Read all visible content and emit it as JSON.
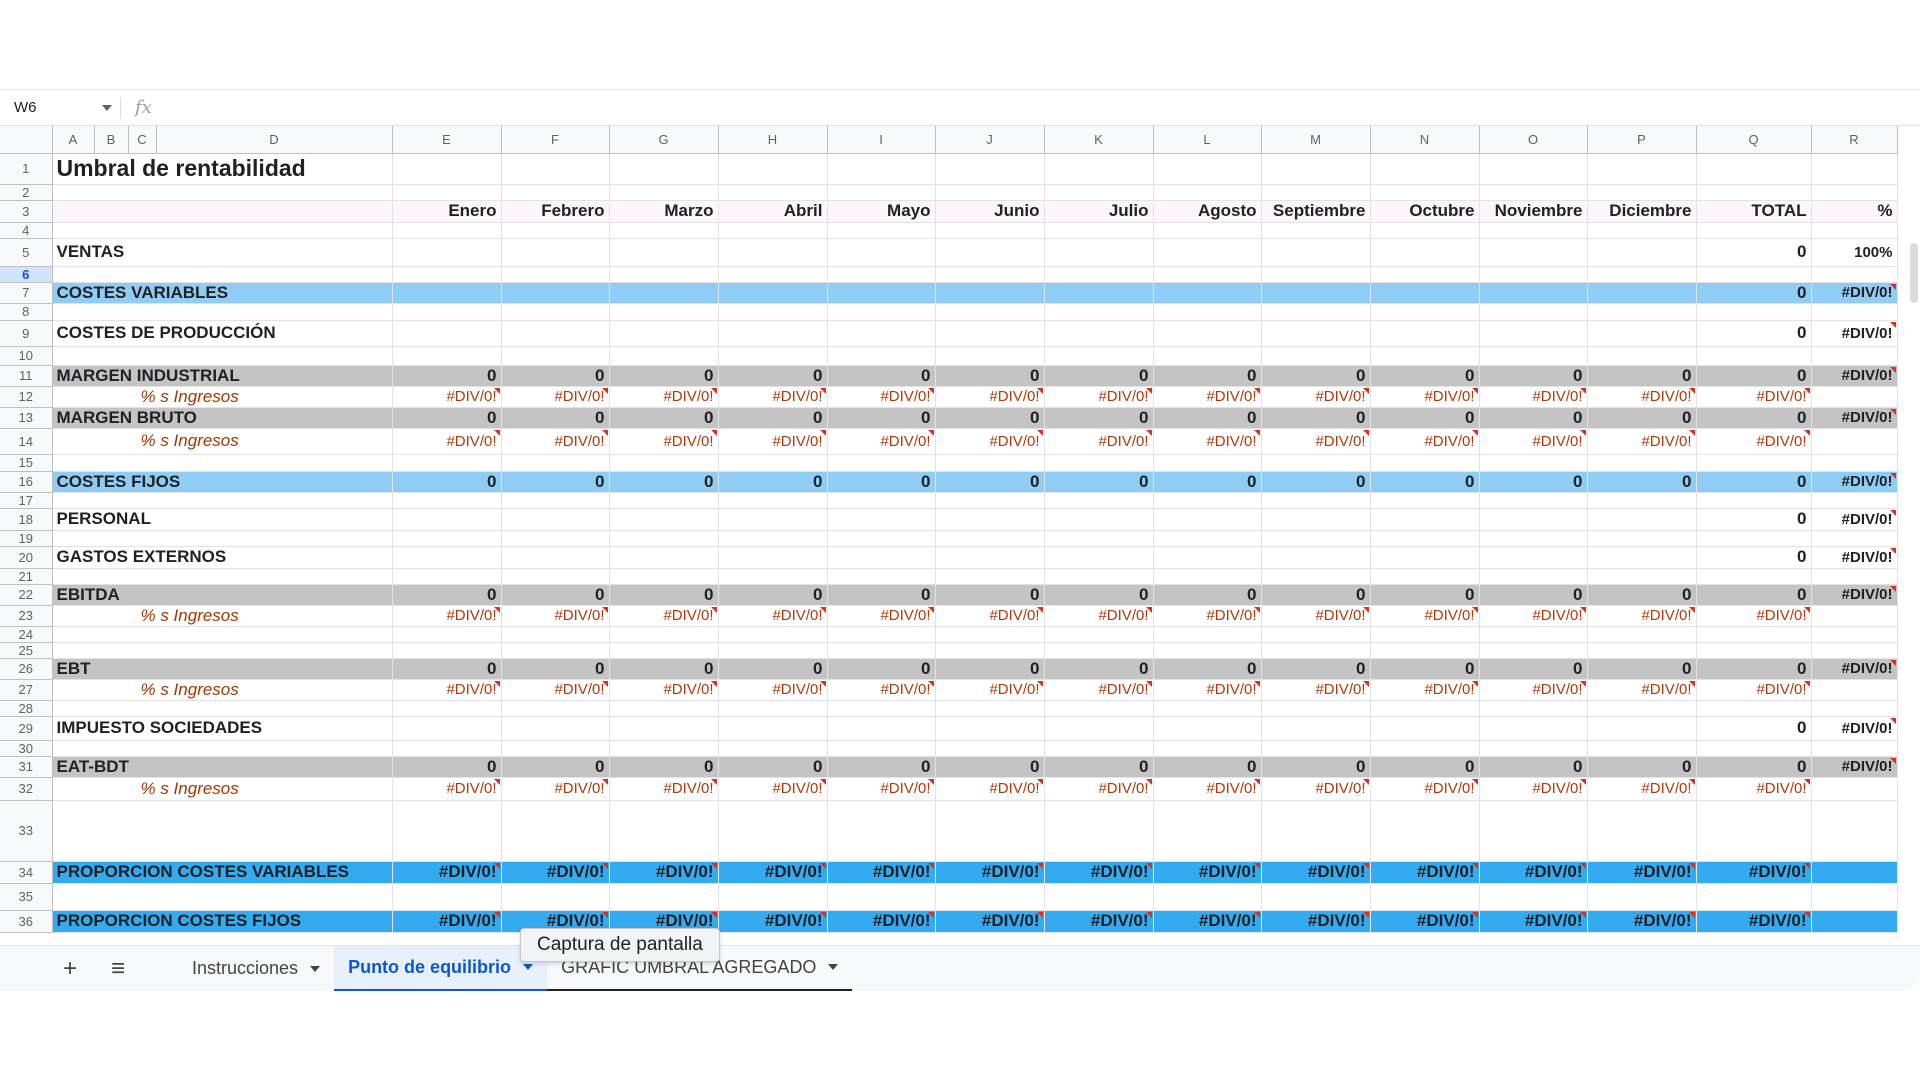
{
  "formula_bar": {
    "cell_ref": "W6",
    "fx_label": "fx",
    "formula": ""
  },
  "columns": [
    "A",
    "B",
    "C",
    "D",
    "E",
    "F",
    "G",
    "H",
    "I",
    "J",
    "K",
    "L",
    "M",
    "N",
    "O",
    "P",
    "Q",
    "R"
  ],
  "months": [
    "Enero",
    "Febrero",
    "Marzo",
    "Abril",
    "Mayo",
    "Junio",
    "Julio",
    "Agosto",
    "Septiembre",
    "Octubre",
    "Noviembre",
    "Diciembre"
  ],
  "title": "Umbral de rentabilidad",
  "header_total": "TOTAL",
  "header_pct": "%",
  "rows": [
    {
      "n": "1",
      "kind": "title"
    },
    {
      "n": "2",
      "kind": "blank"
    },
    {
      "n": "3",
      "kind": "header"
    },
    {
      "n": "4",
      "kind": "blank"
    },
    {
      "n": "5",
      "kind": "label",
      "label": "VENTAS",
      "total": "0",
      "pct": "100%",
      "pct_tri": false
    },
    {
      "n": "6",
      "kind": "blank",
      "selected": true
    },
    {
      "n": "7",
      "kind": "label",
      "style": "blue",
      "label": "COSTES VARIABLES",
      "total": "0",
      "pct": "#DIV/0!",
      "pct_tri": true
    },
    {
      "n": "8",
      "kind": "blank"
    },
    {
      "n": "9",
      "kind": "label",
      "label": "COSTES DE PRODUCCIÓN",
      "total": "0",
      "pct": "#DIV/0!",
      "pct_tri": true
    },
    {
      "n": "10",
      "kind": "blank"
    },
    {
      "n": "11",
      "kind": "months",
      "style": "grey",
      "label": "MARGEN INDUSTRIAL",
      "value": "0",
      "total": "0",
      "pct": "#DIV/0!"
    },
    {
      "n": "12",
      "kind": "pctrow",
      "label": "% s Ingresos",
      "value": "#DIV/0!"
    },
    {
      "n": "13",
      "kind": "months",
      "style": "grey",
      "label": "MARGEN BRUTO",
      "value": "0",
      "total": "0",
      "pct": "#DIV/0!"
    },
    {
      "n": "14",
      "kind": "pctrow",
      "label": "% s Ingresos",
      "value": "#DIV/0!"
    },
    {
      "n": "15",
      "kind": "blank"
    },
    {
      "n": "16",
      "kind": "months",
      "style": "blue",
      "label": "COSTES FIJOS",
      "value": "0",
      "total": "0",
      "pct": "#DIV/0!"
    },
    {
      "n": "17",
      "kind": "blank"
    },
    {
      "n": "18",
      "kind": "label",
      "label": "PERSONAL",
      "total": "0",
      "pct": "#DIV/0!",
      "pct_tri": true
    },
    {
      "n": "19",
      "kind": "blank"
    },
    {
      "n": "20",
      "kind": "label",
      "label": "GASTOS EXTERNOS",
      "total": "0",
      "pct": "#DIV/0!",
      "pct_tri": true
    },
    {
      "n": "21",
      "kind": "blank"
    },
    {
      "n": "22",
      "kind": "months",
      "style": "grey",
      "label": "EBITDA",
      "value": "0",
      "total": "0",
      "pct": "#DIV/0!"
    },
    {
      "n": "23",
      "kind": "pctrow",
      "label": "% s Ingresos",
      "value": "#DIV/0!"
    },
    {
      "n": "24",
      "kind": "blank"
    },
    {
      "n": "25",
      "kind": "blank"
    },
    {
      "n": "26",
      "kind": "months",
      "style": "grey",
      "label": "EBT",
      "value": "0",
      "total": "0",
      "pct": "#DIV/0!"
    },
    {
      "n": "27",
      "kind": "pctrow",
      "label": "% s Ingresos",
      "value": "#DIV/0!"
    },
    {
      "n": "28",
      "kind": "blank"
    },
    {
      "n": "29",
      "kind": "label",
      "label": "IMPUESTO SOCIEDADES",
      "total": "0",
      "pct": "#DIV/0!",
      "pct_tri": true
    },
    {
      "n": "30",
      "kind": "blank"
    },
    {
      "n": "31",
      "kind": "months",
      "style": "grey",
      "label": "EAT-BDT",
      "value": "0",
      "total": "0",
      "pct": "#DIV/0!"
    },
    {
      "n": "32",
      "kind": "pctrow",
      "label": "% s Ingresos",
      "value": "#DIV/0!"
    },
    {
      "n": "33",
      "kind": "blank"
    },
    {
      "n": "34",
      "kind": "bigerr",
      "style": "blue2",
      "label": "PROPORCION COSTES VARIABLES",
      "value": "#DIV/0!"
    },
    {
      "n": "35",
      "kind": "blank"
    },
    {
      "n": "36",
      "kind": "bigerr",
      "style": "blue2",
      "label": "PROPORCION COSTES FIJOS",
      "value": "#DIV/0!"
    }
  ],
  "tabs": {
    "add_icon": "+",
    "menu_icon": "≡",
    "items": [
      {
        "label": "Instrucciones",
        "active": false
      },
      {
        "label": "Punto de equilibrio",
        "active": true
      },
      {
        "label": "GRAFIC UMBRAL AGREGADO",
        "active": false
      }
    ],
    "tooltip": "Captura de pantalla"
  },
  "colors": {
    "blue": "#90cdf5",
    "blue2": "#34aaf0",
    "grey": "#c4c4c4",
    "selection": "#1a73e8",
    "error": "#b23a0a"
  }
}
